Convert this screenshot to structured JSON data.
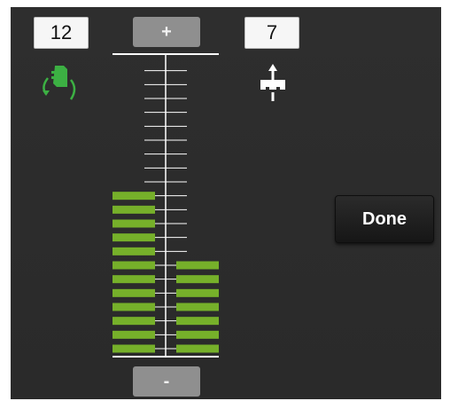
{
  "left_readout": {
    "value": "12",
    "icon": "rotate-grip-icon"
  },
  "right_readout": {
    "value": "7",
    "icon": "lift-arrow-icon"
  },
  "controls": {
    "increase_label": "+",
    "decrease_label": "-",
    "done_label": "Done"
  },
  "colors": {
    "panel_bg": "#2c2c2c",
    "bar_fill": "#76b02a",
    "active_icon": "#3cb043",
    "scale_line": "#ffffff"
  },
  "level_scale": {
    "total_steps": 21,
    "left_level": 12,
    "right_level": 7
  }
}
